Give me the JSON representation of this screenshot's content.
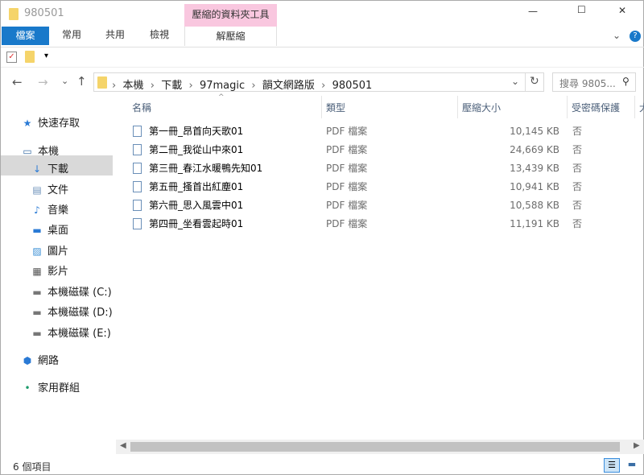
{
  "window": {
    "title": "980501",
    "min": "—",
    "max": "☐",
    "close": "✕"
  },
  "ribbon": {
    "file_tab": "檔案",
    "tabs": [
      "常用",
      "共用",
      "檢視"
    ],
    "context_group": "壓縮的資料夾工具",
    "context_tab": "解壓縮",
    "help": "?"
  },
  "qat": {
    "dropdown": "▾"
  },
  "address": {
    "crumbs": [
      "本機",
      "下載",
      "97magic",
      "韻文網路版",
      "980501"
    ],
    "search_placeholder": "搜尋 9805..."
  },
  "columns": [
    "名稱",
    "類型",
    "壓縮大小",
    "受密碼保護",
    "大"
  ],
  "sidebar": [
    {
      "label": "快速存取",
      "icon": "star-icon"
    },
    {
      "label": "本機",
      "icon": "computer-icon"
    },
    {
      "label": "下載",
      "icon": "download-icon",
      "selected": true
    },
    {
      "label": "文件",
      "icon": "document-icon"
    },
    {
      "label": "音樂",
      "icon": "music-icon"
    },
    {
      "label": "桌面",
      "icon": "desktop-icon"
    },
    {
      "label": "圖片",
      "icon": "picture-icon"
    },
    {
      "label": "影片",
      "icon": "video-icon"
    },
    {
      "label": "本機磁碟 (C:)",
      "icon": "drive-icon"
    },
    {
      "label": "本機磁碟 (D:)",
      "icon": "drive-icon"
    },
    {
      "label": "本機磁碟 (E:)",
      "icon": "drive-icon"
    },
    {
      "label": "網路",
      "icon": "network-icon"
    },
    {
      "label": "家用群組",
      "icon": "homegroup-icon"
    }
  ],
  "files": [
    {
      "name": "第一冊_昂首向天歌01",
      "type": "PDF 檔案",
      "size": "10,145 KB",
      "protected": "否"
    },
    {
      "name": "第二冊_我從山中來01",
      "type": "PDF 檔案",
      "size": "24,669 KB",
      "protected": "否"
    },
    {
      "name": "第三冊_春江水暖鴨先知01",
      "type": "PDF 檔案",
      "size": "13,439 KB",
      "protected": "否"
    },
    {
      "name": "第五冊_搔首出紅塵01",
      "type": "PDF 檔案",
      "size": "10,941 KB",
      "protected": "否"
    },
    {
      "name": "第六冊_思入風雲中01",
      "type": "PDF 檔案",
      "size": "10,588 KB",
      "protected": "否"
    },
    {
      "name": "第四冊_坐看雲起時01",
      "type": "PDF 檔案",
      "size": "11,191 KB",
      "protected": "否"
    }
  ],
  "status": {
    "count": "6 個項目"
  }
}
